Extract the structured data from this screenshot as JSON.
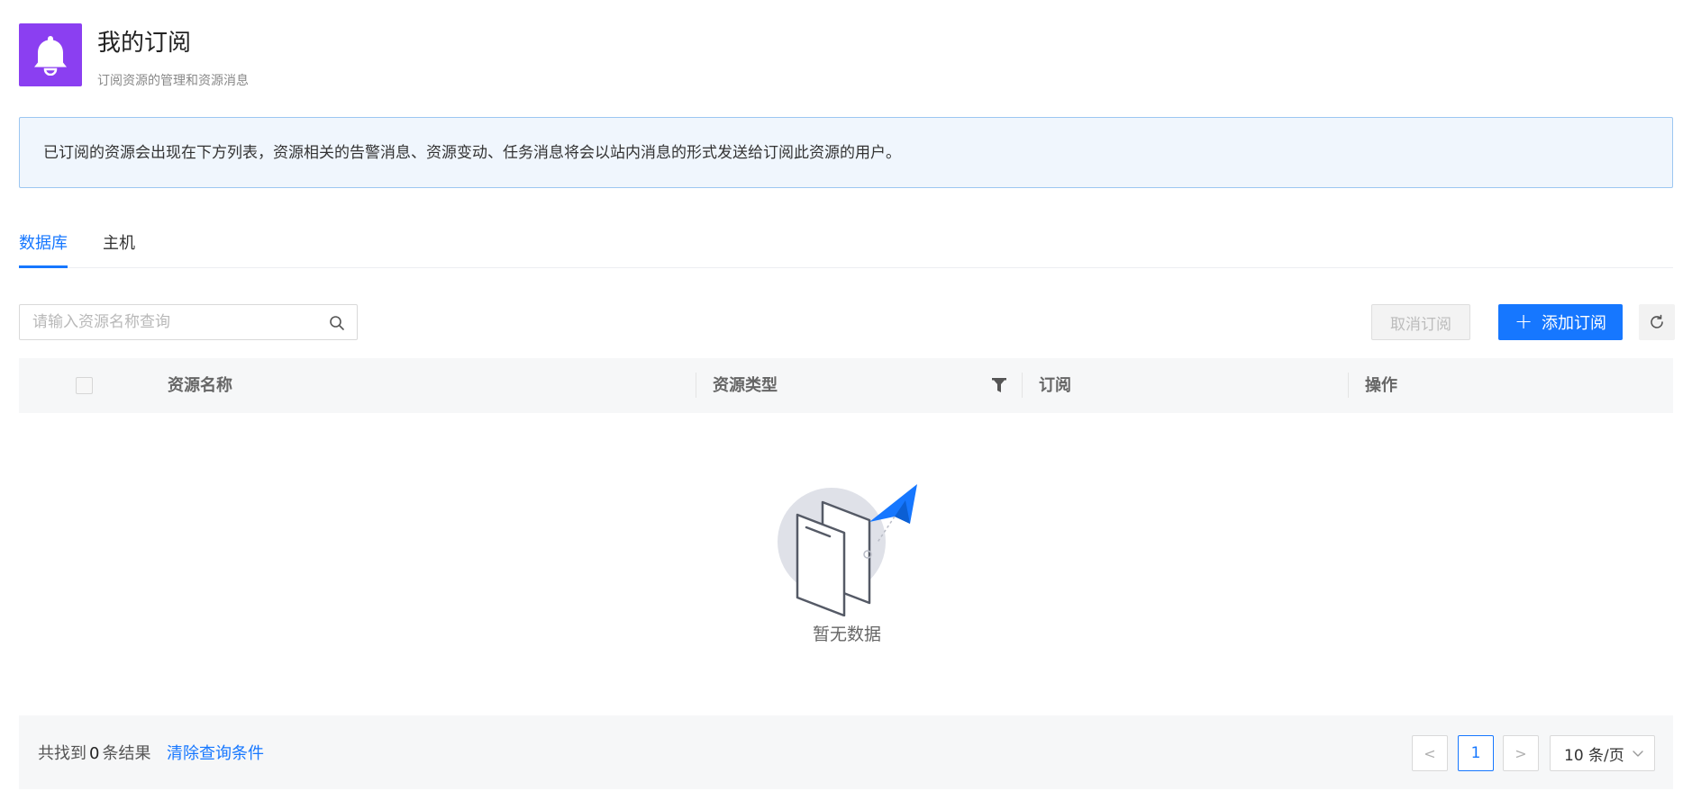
{
  "header": {
    "title": "我的订阅",
    "subtitle": "订阅资源的管理和资源消息",
    "icon": "bell-icon",
    "icon_bg": "#8b3ff1"
  },
  "notice": {
    "text": "已订阅的资源会出现在下方列表，资源相关的告警消息、资源变动、任务消息将会以站内消息的形式发送给订阅此资源的用户。"
  },
  "tabs": [
    {
      "label": "数据库",
      "active": true
    },
    {
      "label": "主机",
      "active": false
    }
  ],
  "toolbar": {
    "search_placeholder": "请输入资源名称查询",
    "search_value": "",
    "cancel_label": "取消订阅",
    "add_label": "添加订阅",
    "accent": "#1677ff"
  },
  "table": {
    "columns": [
      "资源名称",
      "资源类型",
      "订阅",
      "操作"
    ],
    "rows": [],
    "empty_text": "暂无数据"
  },
  "footer": {
    "total_prefix": "共找到",
    "total_count": "0",
    "total_suffix": "条结果",
    "clear_label": "清除查询条件",
    "prev": "<",
    "current_page": "1",
    "next": ">",
    "page_size": "10 条/页"
  }
}
